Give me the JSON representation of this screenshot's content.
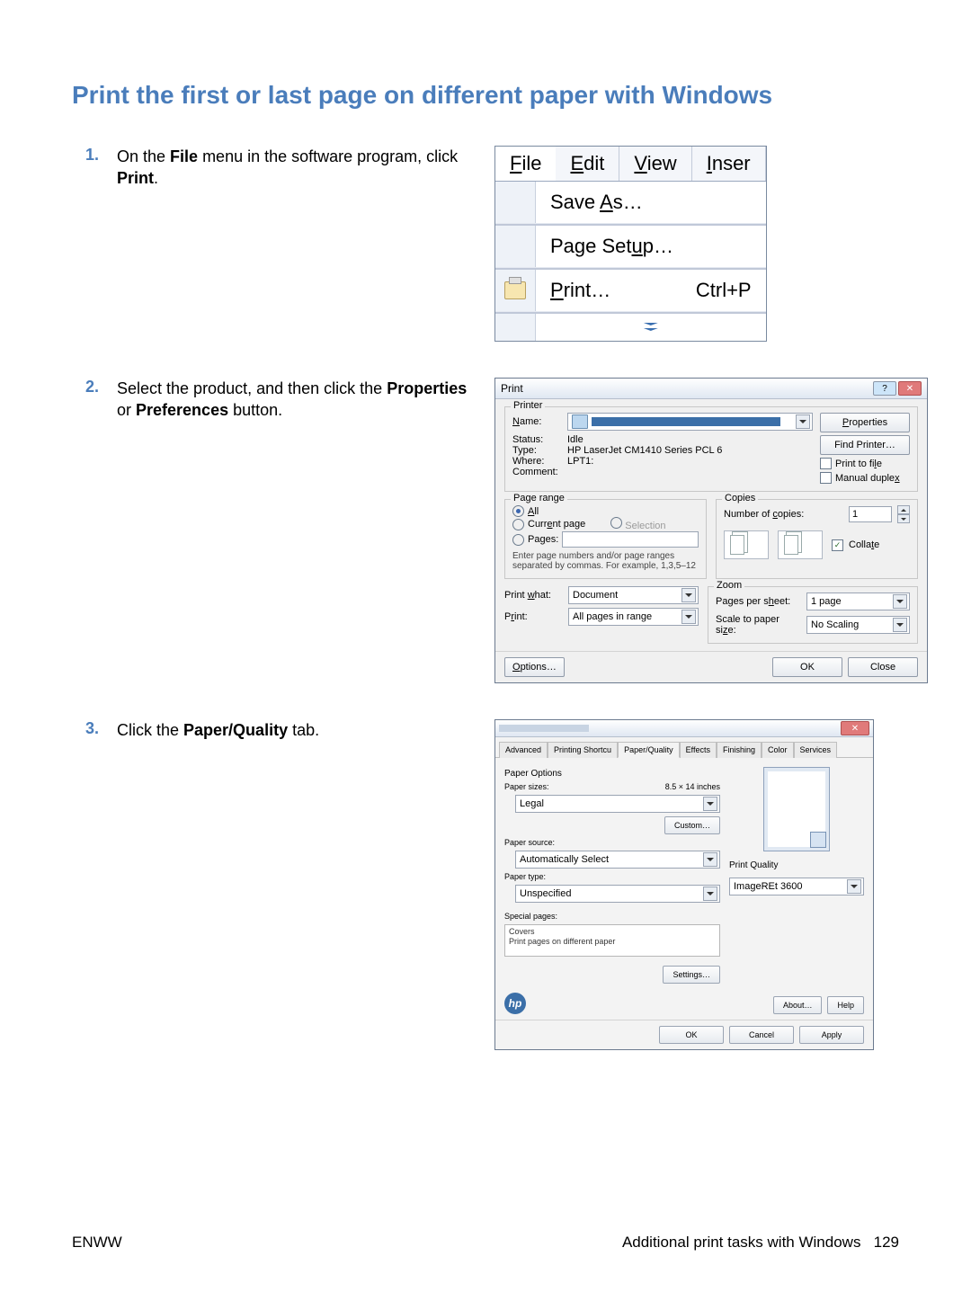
{
  "heading": "Print the first or last page on different paper with Windows",
  "steps": {
    "s1": {
      "num": "1.",
      "text_a": "On the ",
      "text_b": "File",
      "text_c": " menu in the software program, click ",
      "text_d": "Print",
      "text_e": "."
    },
    "s2": {
      "num": "2.",
      "text_a": "Select the product, and then click the ",
      "text_b": "Properties",
      "text_c": " or ",
      "text_d": "Preferences",
      "text_e": " button."
    },
    "s3": {
      "num": "3.",
      "text_a": "Click the ",
      "text_b": "Paper/Quality",
      "text_c": " tab."
    }
  },
  "menu": {
    "file": "File",
    "edit": "Edit",
    "view": "View",
    "insert": "Inser",
    "save_as": "Save As…",
    "page_setup": "Page Setup…",
    "print": "Print…",
    "print_sc": "Ctrl+P"
  },
  "print_dialog": {
    "title": "Print",
    "printer_legend": "Printer",
    "name_label": "Name:",
    "status_label": "Status:",
    "status_value": "Idle",
    "type_label": "Type:",
    "type_value": "HP LaserJet CM1410 Series PCL 6",
    "where_label": "Where:",
    "where_value": "LPT1:",
    "comment_label": "Comment:",
    "properties_btn": "Properties",
    "find_printer_btn": "Find Printer…",
    "print_to_file": "Print to file",
    "manual_duplex": "Manual duplex",
    "page_range_legend": "Page range",
    "all": "All",
    "current": "Current page",
    "selection": "Selection",
    "pages": "Pages:",
    "pages_hint": "Enter page numbers and/or page ranges separated by commas. For example, 1,3,5–12",
    "copies_legend": "Copies",
    "num_copies_label": "Number of copies:",
    "num_copies_value": "1",
    "collate": "Collate",
    "print_what_label": "Print what:",
    "print_what_value": "Document",
    "print_label": "Print:",
    "print_value": "All pages in range",
    "zoom_legend": "Zoom",
    "pps_label": "Pages per sheet:",
    "pps_value": "1 page",
    "scale_label": "Scale to paper size:",
    "scale_value": "No Scaling",
    "options_btn": "Options…",
    "ok_btn": "OK",
    "close_btn": "Close"
  },
  "props_dialog": {
    "tabs": {
      "advanced": "Advanced",
      "shortcuts": "Printing Shortcu",
      "paper": "Paper/Quality",
      "effects": "Effects",
      "finishing": "Finishing",
      "color": "Color",
      "services": "Services"
    },
    "paper_options_legend": "Paper Options",
    "paper_sizes_label": "Paper sizes:",
    "paper_sizes_dim": "8.5 × 14 inches",
    "paper_sizes_value": "Legal",
    "custom_btn": "Custom…",
    "paper_source_label": "Paper source:",
    "paper_source_value": "Automatically Select",
    "paper_type_label": "Paper type:",
    "paper_type_value": "Unspecified",
    "special_pages_label": "Special pages:",
    "special_item1": "Covers",
    "special_item2": "Print pages on different paper",
    "settings_btn": "Settings…",
    "print_quality_legend": "Print Quality",
    "print_quality_value": "ImageREt 3600",
    "about_btn": "About…",
    "help_btn": "Help",
    "ok_btn": "OK",
    "cancel_btn": "Cancel",
    "apply_btn": "Apply"
  },
  "footer": {
    "left": "ENWW",
    "right_text": "Additional print tasks with Windows",
    "page": "129"
  }
}
